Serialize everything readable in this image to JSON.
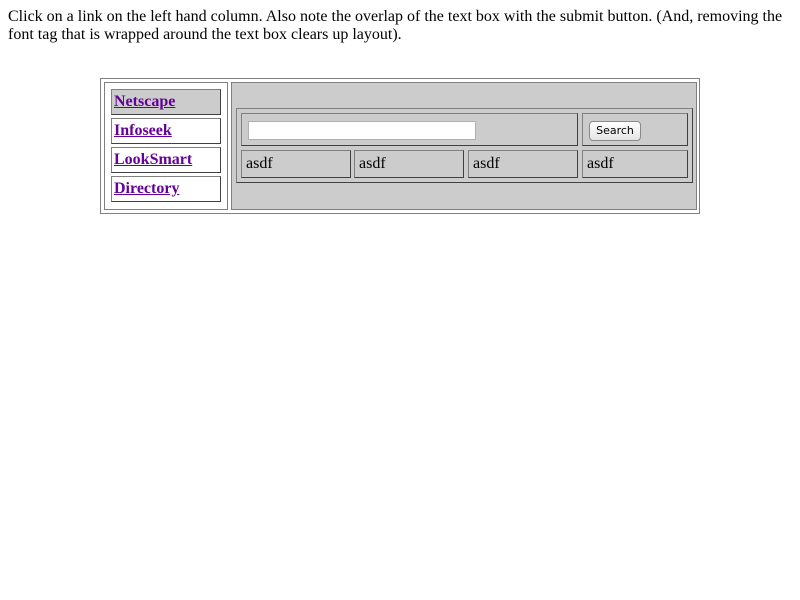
{
  "intro_text": "Click on a link on the left hand column. Also note the overlap of the text box with the submit button. (And, removing the font tag that is wrapped around the text box clears up layout).",
  "nav": {
    "items": [
      {
        "label": "Netscape"
      },
      {
        "label": "Infoseek"
      },
      {
        "label": "LookSmart"
      },
      {
        "label": "Directory"
      }
    ]
  },
  "search": {
    "value": "",
    "button_label": "Search"
  },
  "cells": [
    "asdf",
    "asdf",
    "asdf",
    "asdf"
  ],
  "colors": {
    "panel_bg": "#cccccc",
    "link": "#660099",
    "border": "#808080"
  }
}
